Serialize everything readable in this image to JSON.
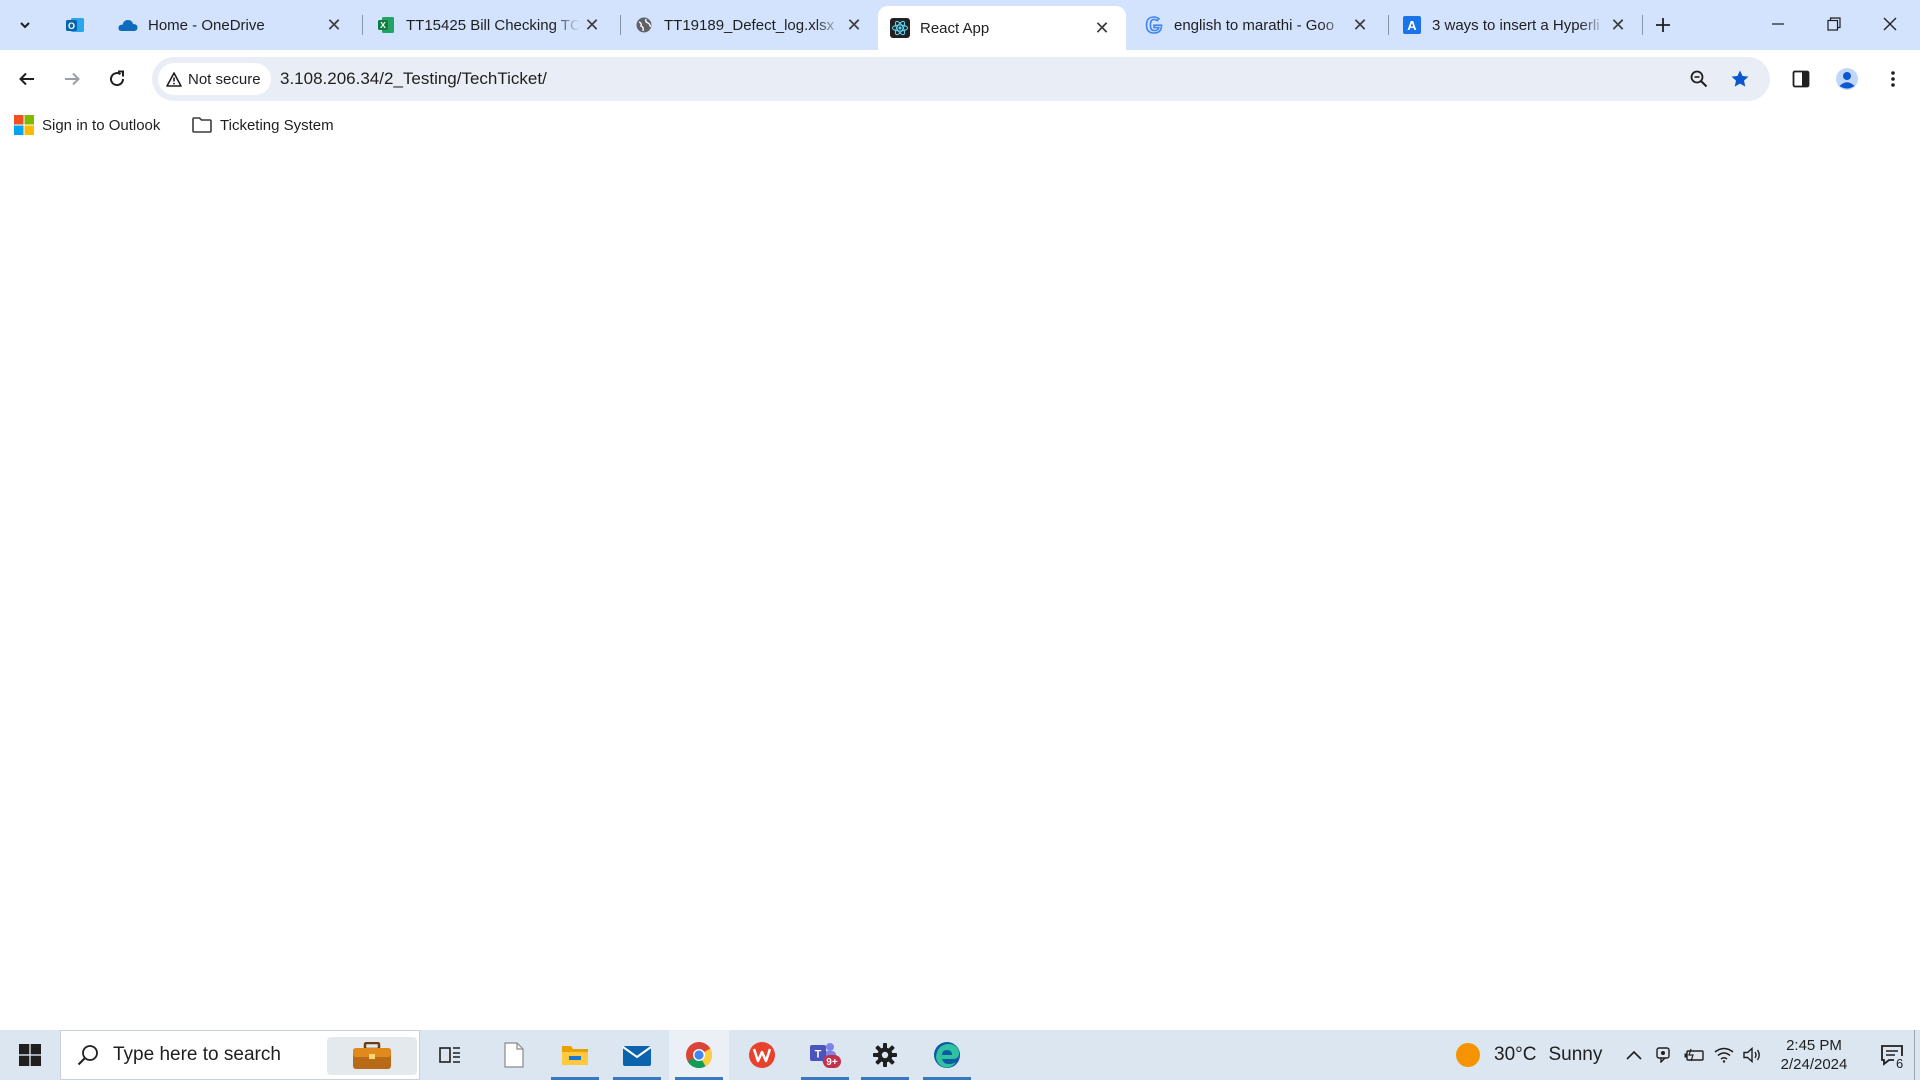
{
  "browser": {
    "tabs": [
      {
        "title": "Home - OneDrive",
        "favicon": "onedrive-icon"
      },
      {
        "title": "TT15425 Bill Checking TC",
        "favicon": "excel-icon"
      },
      {
        "title": "TT19189_Defect_log.xlsx",
        "favicon": "globe-icon"
      },
      {
        "title": "React App",
        "favicon": "react-icon",
        "active": true
      },
      {
        "title": "english to marathi - Goo",
        "favicon": "google-icon"
      },
      {
        "title": "3 ways to insert a Hyperli",
        "favicon": "doc-a-icon"
      }
    ],
    "pinned_tab_icon": "outlook-icon",
    "security_label": "Not secure",
    "url": "3.108.206.34/2_Testing/TechTicket/",
    "bookmarks": [
      {
        "label": "Sign in to Outlook",
        "icon": "microsoft-icon"
      },
      {
        "label": "Ticketing System",
        "icon": "folder-icon"
      }
    ]
  },
  "taskbar": {
    "search_placeholder": "Type here to search",
    "apps": [
      "task-view",
      "file",
      "file-explorer",
      "mail",
      "chrome",
      "wps-office",
      "teams",
      "settings",
      "edge"
    ],
    "teams_badge": "9+",
    "weather": {
      "temp": "30°C",
      "condition": "Sunny"
    },
    "time": "2:45 PM",
    "date": "2/24/2024",
    "notification_count": "6"
  },
  "colors": {
    "tabstrip": "#d3e3fd",
    "omnibox": "#e9eef6",
    "taskbar": "#dbe6f0",
    "accent": "#0b57d0"
  }
}
